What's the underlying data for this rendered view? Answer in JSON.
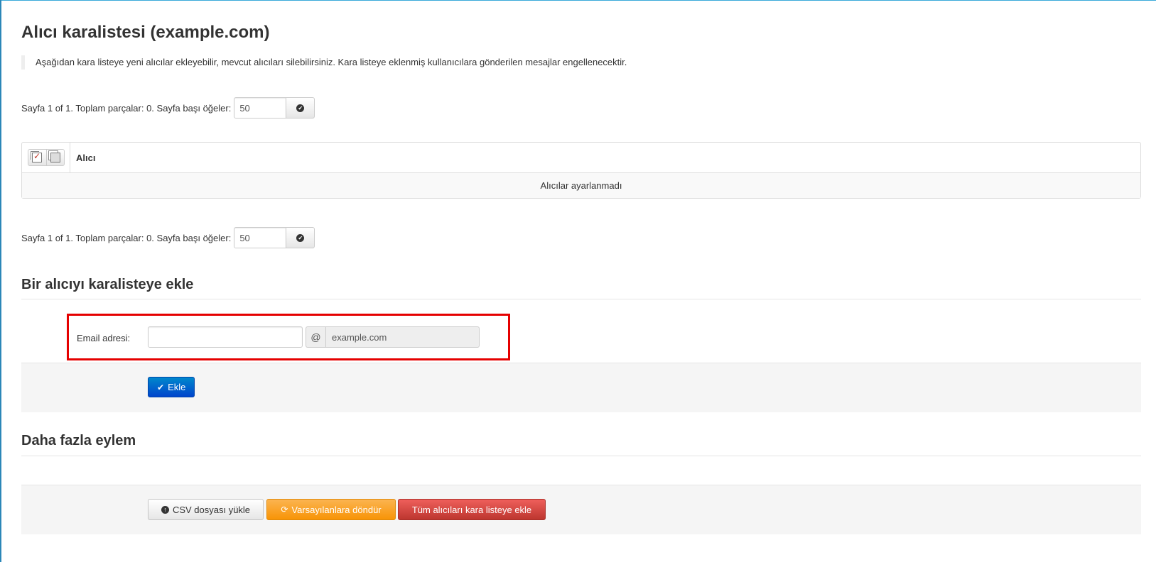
{
  "page": {
    "title": "Alıcı karalistesi (example.com)",
    "notice": "Aşağıdan kara listeye yeni alıcılar ekleyebilir, mevcut alıcıları silebilirsiniz. Kara listeye eklenmiş kullanıcılara gönderilen mesajlar engellenecektir."
  },
  "pager_top": {
    "text": "Sayfa 1 of 1. Toplam parçalar: 0. Sayfa başı öğeler:",
    "per_page_value": "50",
    "go_icon": "check-circle-icon"
  },
  "pager_bottom": {
    "text": "Sayfa 1 of 1. Toplam parçalar: 0. Sayfa başı öğeler:",
    "per_page_value": "50",
    "go_icon": "check-circle-icon"
  },
  "table": {
    "select_icons": [
      "select-all-icon",
      "invert-selection-icon"
    ],
    "column_header": "Alıcı",
    "empty_message": "Alıcılar ayarlanmadı"
  },
  "add_section": {
    "title": "Bir alıcıyı karalisteye ekle",
    "email_label": "Email adresi:",
    "email_value": "",
    "at_sign": "@",
    "domain": "example.com",
    "add_button": "Ekle",
    "add_icon": "check-icon",
    "highlight_color": "#e50000"
  },
  "more_section": {
    "title": "Daha fazla eylem",
    "csv_button": "CSV dosyası yükle",
    "csv_icon": "upload-circle-icon",
    "reset_button": "Varsayılanlara döndür",
    "reset_icon": "refresh-icon",
    "blacklist_all_button": "Tüm alıcıları kara listeye ekle"
  },
  "colors": {
    "primary": "#0055cc",
    "warning": "#f89406",
    "danger": "#bd362f"
  }
}
